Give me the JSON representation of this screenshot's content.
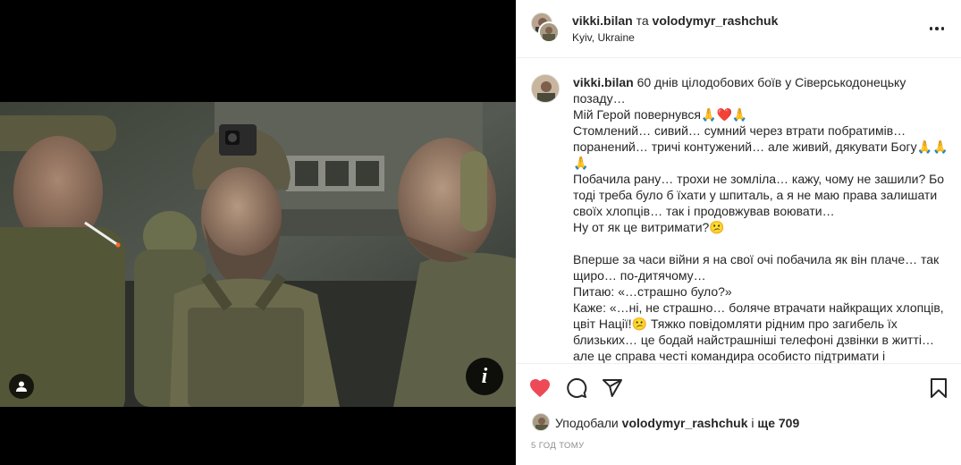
{
  "post": {
    "author": "vikki.bilan",
    "joiner": "та",
    "coauthor": "volodymyr_rashchuk",
    "location": "Kyiv, Ukraine",
    "photo_alt": "Photo by vikki.bilan",
    "info_label": "i"
  },
  "caption": {
    "author": "vikki.bilan",
    "first_line": "60 днів цілодобових боїв у Сіверськодонецьку позаду…",
    "lines": [
      "Мій Герой повернувся🙏❤️🙏",
      "Стомлений… сивий… сумний через втрати побратимів… поранений… тричі контужений… але живий, дякувати Богу🙏🙏🙏",
      "Побачила рану… трохи не зомліла… кажу, чому не зашили? Бо тоді треба було б їхати у шпиталь, а я не маю права залишати своїх хлопців… так і продовжував воювати…",
      "Ну от як це витримати?😕",
      "",
      "Вперше за часи війни я на свої очі побачила як він плаче… так щиро… по-дитячому…",
      "Питаю: «…страшно було?»",
      "Каже: «…ні, не страшно… боляче втрачати найкращих хлопців, цвіт Нації!😕 Тяжко повідомляти рідним про загибель їх близьких… це бодай найстрашніші телефоні дзвінки в житті… але це справа честі командира особисто підтримати і"
    ]
  },
  "actions": {
    "like_icon": "heart-filled-icon",
    "comment_icon": "comment-icon",
    "share_icon": "share-icon",
    "save_icon": "bookmark-icon",
    "like_color": "#ed4956"
  },
  "likes": {
    "prefix": "Уподобали",
    "user": "volodymyr_rashchuk",
    "middle": "і",
    "count": "ще 709"
  },
  "time": "5 год тому"
}
